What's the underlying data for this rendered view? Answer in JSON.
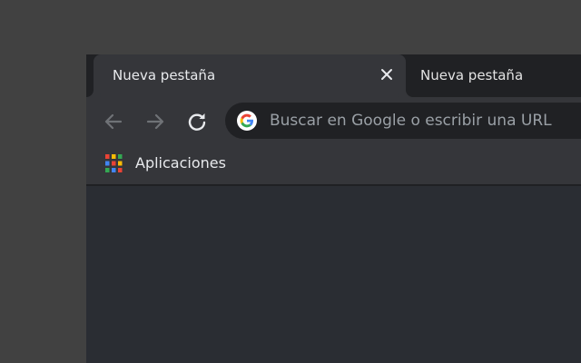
{
  "tabs": [
    {
      "title": "Nueva pestaña",
      "active": true
    },
    {
      "title": "Nueva pestaña",
      "active": false
    }
  ],
  "toolbar": {
    "back_icon": "arrow-left-icon",
    "forward_icon": "arrow-right-icon",
    "reload_icon": "reload-icon"
  },
  "omnibox": {
    "placeholder": "Buscar en Google o escribir una URL",
    "icon": "google-g-icon"
  },
  "bookmarks": {
    "apps_label": "Aplicaciones",
    "apps_icon": "apps-grid-icon"
  },
  "colors": {
    "desktop": "#414141",
    "tabstrip": "#202124",
    "active_tab": "#35363a",
    "omnibox": "#202124",
    "content": "#2a2d33"
  }
}
